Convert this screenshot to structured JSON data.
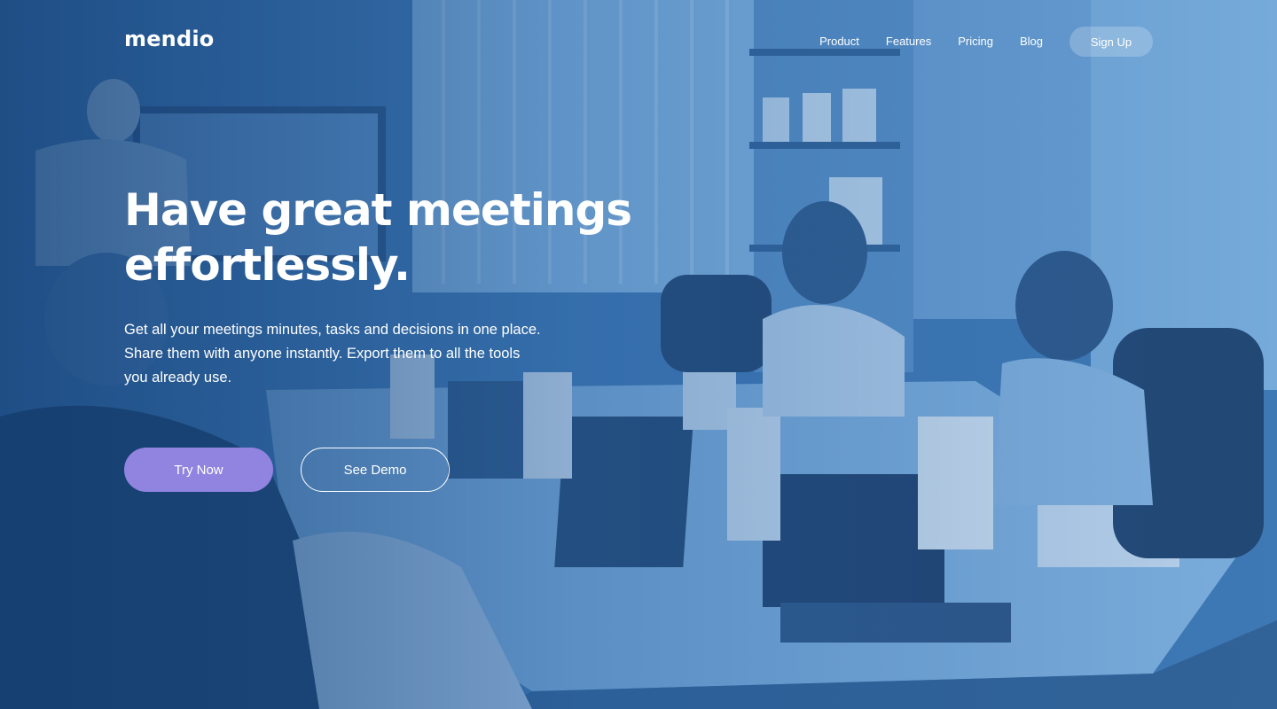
{
  "nav": {
    "logo": "mendio",
    "links": [
      "Product",
      "Features",
      "Pricing",
      "Blog"
    ],
    "signup_label": "Sign Up"
  },
  "hero": {
    "headline_line1": "Have great meetings",
    "headline_line2": "effortlessly.",
    "subtext": "Get all your meetings minutes, tasks and decisions in one place. Share them with anyone instantly. Export them to all the tools you already use.",
    "primary_button": "Try Now",
    "secondary_button": "See Demo",
    "background_image": "meeting-room-photo"
  },
  "colors": {
    "primary_button": "#9184e0",
    "overlay": "#2b64a3",
    "text": "#ffffff"
  }
}
